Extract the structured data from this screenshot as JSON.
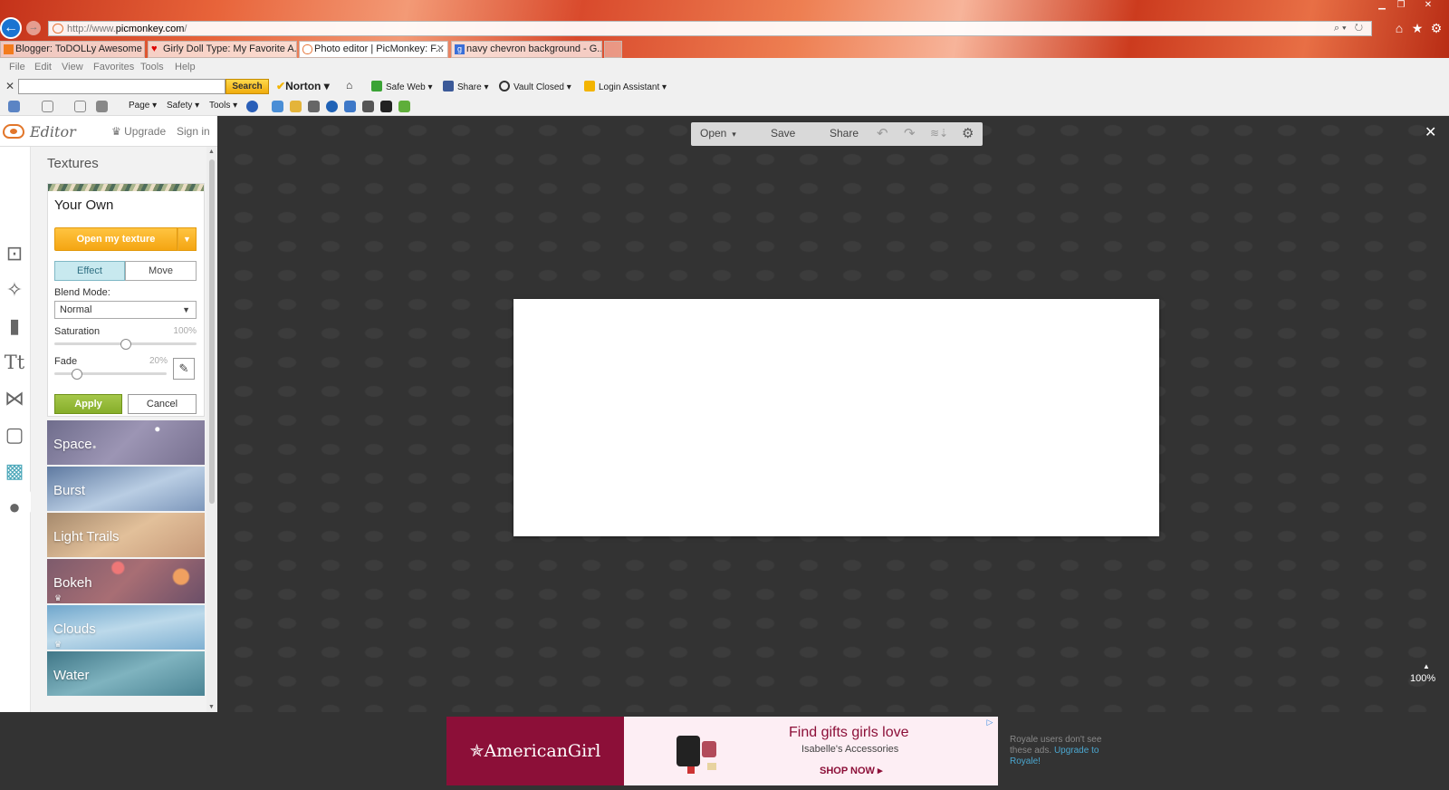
{
  "browser": {
    "url_prefix": "http://www.",
    "url_domain": "picmonkey.com",
    "url_suffix": "/",
    "tabs": [
      {
        "title": "Blogger: ToDOLLy Awesome - ...",
        "active": false
      },
      {
        "title": "Girly Doll Type: My Favorite A...",
        "active": false
      },
      {
        "title": "Photo editor | PicMonkey: F...",
        "active": true
      },
      {
        "title": "navy chevron background - G...",
        "active": false
      }
    ],
    "menu": [
      "File",
      "Edit",
      "View",
      "Favorites",
      "Tools",
      "Help"
    ],
    "norton_toolbar": {
      "search_label": "Search",
      "norton_label": "Norton ▾",
      "safe_web_label": "Safe Web ▾",
      "share_label": "Share ▾",
      "vault_label": "Vault Closed ▾",
      "login_label": "Login Assistant ▾"
    },
    "command_bar": {
      "page_label": "Page ▾",
      "safety_label": "Safety ▾",
      "tools_label": "Tools ▾"
    }
  },
  "app": {
    "editor_label": "Editor",
    "upgrade_label": "Upgrade",
    "signin_label": "Sign in",
    "toolbar": {
      "open_label": "Open",
      "save_label": "Save",
      "share_label": "Share"
    },
    "panel": {
      "title": "Textures",
      "own_card": {
        "title": "Your Own",
        "open_button": "Open my texture",
        "effect_tab": "Effect",
        "move_tab": "Move",
        "blend_mode_label": "Blend Mode:",
        "blend_mode_value": "Normal",
        "saturation_label": "Saturation",
        "saturation_value": "100%",
        "saturation_level": 0.5,
        "fade_label": "Fade",
        "fade_value": "20%",
        "fade_level": 0.2,
        "apply_label": "Apply",
        "cancel_label": "Cancel"
      },
      "textures": [
        {
          "name": "Space",
          "premium": false
        },
        {
          "name": "Burst",
          "premium": false
        },
        {
          "name": "Light Trails",
          "premium": false
        },
        {
          "name": "Bokeh",
          "premium": true
        },
        {
          "name": "Clouds",
          "premium": true
        },
        {
          "name": "Water",
          "premium": false
        }
      ]
    },
    "zoom_level": "100%"
  },
  "ad": {
    "brand": "✯AmericanGirl",
    "headline": "Find gifts girls love",
    "subhead": "Isabelle's Accessories",
    "cta": "SHOP NOW ▸",
    "royale_note": "Royale users don't see these ads.",
    "royale_link": "Upgrade to Royale!"
  },
  "colors": {
    "accent_teal": "#4ba7b9",
    "button_orange": "#f4a512",
    "apply_green": "#86ad2a",
    "ad_burgundy": "#8c0f38"
  }
}
